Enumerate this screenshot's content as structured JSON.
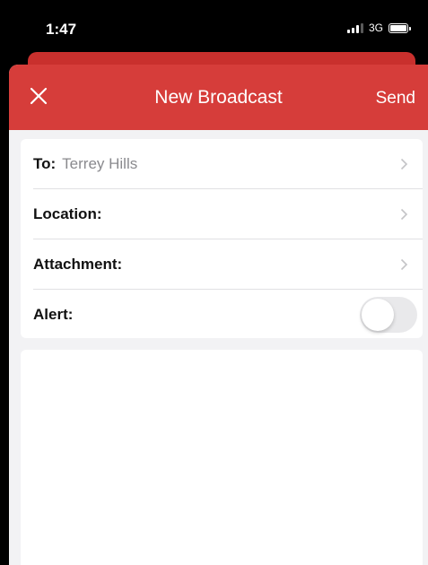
{
  "status_bar": {
    "time": "1:47",
    "network": "3G"
  },
  "nav": {
    "title": "New Broadcast",
    "send_label": "Send",
    "close_icon": "close-icon",
    "accent_color": "#d63d3a"
  },
  "form": {
    "to_label": "To:",
    "to_value": "Terrey Hills",
    "location_label": "Location:",
    "attachment_label": "Attachment:",
    "alert_label": "Alert:",
    "alert_enabled": false
  }
}
